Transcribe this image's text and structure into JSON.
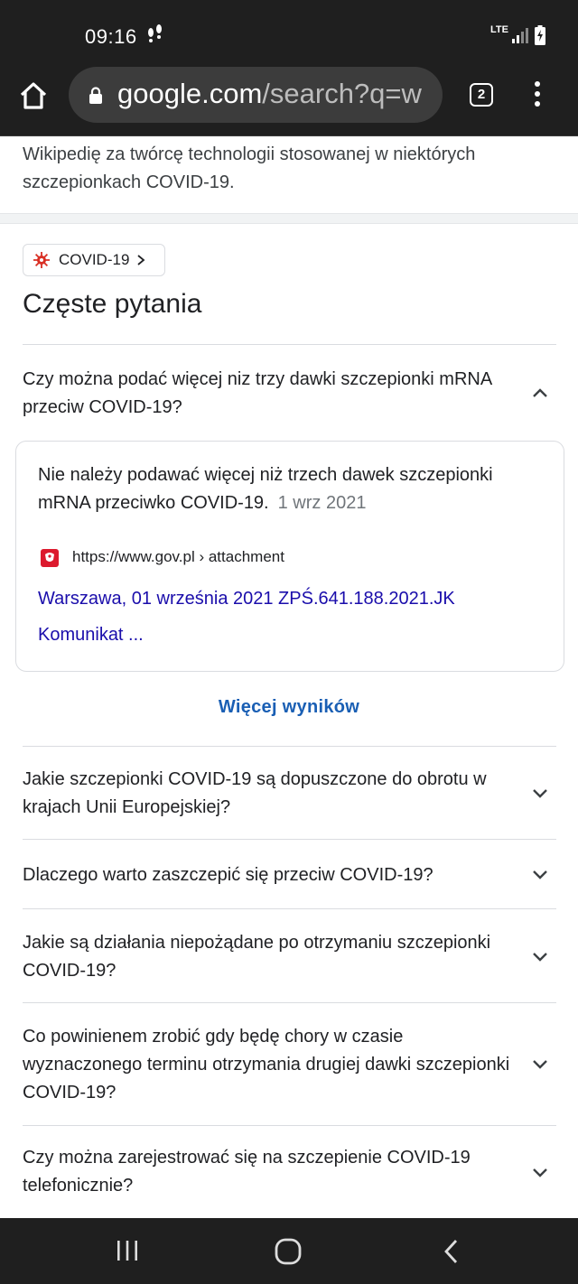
{
  "status_bar": {
    "time": "09:16",
    "network": "LTE"
  },
  "browser": {
    "url_main": "google.com",
    "url_rest": "/search?q=w",
    "tab_count": "2"
  },
  "previous_result": {
    "snippet": "Wikipedię za twórcę technologii stosowanej w niektórych szczepionkach COVID-19."
  },
  "topic_chip": {
    "label": "COVID-19"
  },
  "faq": {
    "heading": "Częste pytania",
    "expanded": {
      "question": "Czy można podać więcej niz trzy dawki szczepionki mRNA przeciw COVID-19?",
      "answer": "Nie należy podawać więcej niż trzech dawek szczepionki mRNA przeciwko COVID-19.",
      "date": "1 wrz 2021",
      "source_url": "https://www.gov.pl › attachment",
      "result_title_line1": "Warszawa, 01 września 2021 ZPŚ.641.188.2021.JK",
      "result_title_line2": "Komunikat ..."
    },
    "more_results": "Więcej wyników",
    "questions": [
      "Jakie szczepionki COVID-19 są dopuszczone do obrotu w krajach Unii Europejskiej?",
      "Dlaczego warto zaszczepić się przeciw COVID-19?",
      "Jakie są działania niepożądane po otrzymaniu szczepionki COVID-19?",
      "Co powinienem zrobić gdy będę chory w czasie wyznaczonego terminu otrzymania drugiej dawki szczepionki COVID-19?",
      "Czy można zarejestrować się na szczepienie COVID-19 telefonicznie?"
    ]
  },
  "colors": {
    "link": "#1a0dab",
    "more_results": "#1a5fb4",
    "system_bar": "#1f1f1f"
  }
}
